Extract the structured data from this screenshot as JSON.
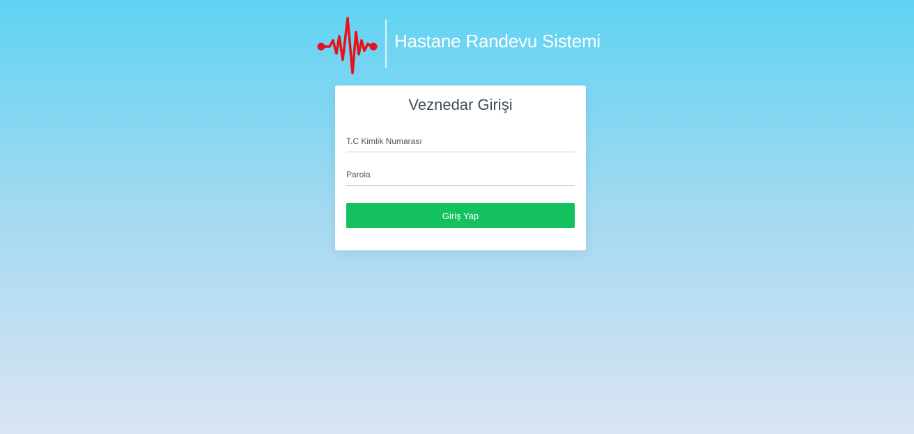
{
  "header": {
    "logo_icon": "heartbeat-pulse-icon",
    "brand_title": "Hastane Randevu Sistemi"
  },
  "login_card": {
    "title": "Veznedar Girişi",
    "tc_field": {
      "placeholder": "T.C Kimlik Numarası",
      "value": ""
    },
    "password_field": {
      "placeholder": "Parola",
      "value": ""
    },
    "submit_label": "Giriş Yap"
  },
  "colors": {
    "background_top": "#5fd3f3",
    "background_bottom": "#dbe4f2",
    "pulse_red": "#e8101a",
    "button_green": "#13c25f",
    "title_text": "#3f4d5a"
  }
}
